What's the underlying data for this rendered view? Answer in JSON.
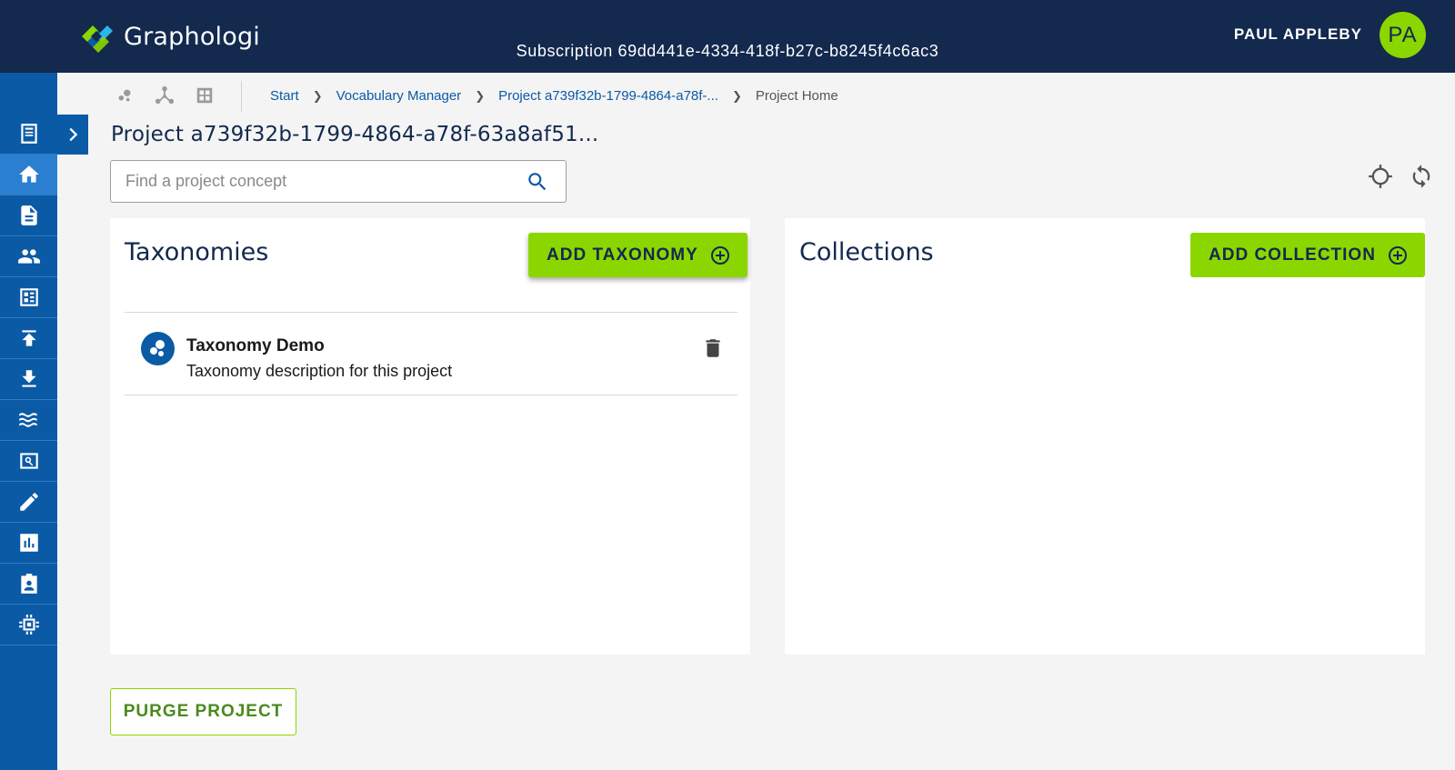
{
  "app": {
    "name": "Graphologi",
    "subscription": "Subscription 69dd441e-4334-418f-b27c-b8245f4c6ac3",
    "user_name": "PAUL APPLEBY",
    "user_initials": "PA",
    "accent_color": "#8cd600",
    "brand_color": "#13294e",
    "sidebar_color": "#0b5aa6"
  },
  "sidebar": {
    "items": [
      {
        "icon": "document-list-icon"
      },
      {
        "icon": "home-icon",
        "active": true
      },
      {
        "icon": "file-icon"
      },
      {
        "icon": "people-icon"
      },
      {
        "icon": "dashboard-icon"
      },
      {
        "icon": "upload-icon"
      },
      {
        "icon": "download-icon"
      },
      {
        "icon": "waves-icon"
      },
      {
        "icon": "image-search-icon"
      },
      {
        "icon": "edit-icon"
      },
      {
        "icon": "chart-icon"
      },
      {
        "icon": "badge-icon"
      },
      {
        "icon": "chip-icon"
      }
    ]
  },
  "breadcrumb": {
    "items": [
      "Start",
      "Vocabulary Manager",
      "Project a739f32b-1799-4864-a78f-..."
    ],
    "current": "Project Home"
  },
  "page": {
    "title": "Project a739f32b-1799-4864-a78f-63a8af51..."
  },
  "search": {
    "placeholder": "Find a project concept",
    "value": ""
  },
  "taxonomies": {
    "title": "Taxonomies",
    "add_label": "ADD TAXONOMY",
    "items": [
      {
        "name": "Taxonomy Demo",
        "description": "Taxonomy description for this project"
      }
    ]
  },
  "collections": {
    "title": "Collections",
    "add_label": "ADD COLLECTION",
    "items": []
  },
  "actions": {
    "purge_label": "PURGE PROJECT"
  }
}
